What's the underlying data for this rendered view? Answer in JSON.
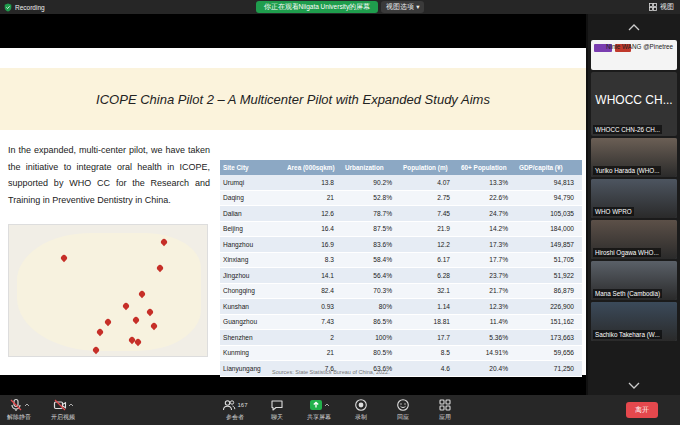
{
  "top_bar": {
    "recording": "Recording",
    "banner": "你正在观看Niigata University的屏幕",
    "view_options": "视图选项",
    "view_options_caret": "▾",
    "view": "视图"
  },
  "slide": {
    "title": "ICOPE China Pilot 2 – A Multicenter Pilot with Expanded Study Aims",
    "paragraph": "In the expanded, multi-center pilot, we have taken the initiative to integrate oral health in ICOPE, supported by WHO CC for the Research and Training in Preventive Dentistry in China.",
    "table": {
      "columns": [
        "Site City",
        "Area (000sqkm)",
        "Urbanization",
        "Population (m)",
        "60+ Population",
        "GDP/capita (¥)"
      ],
      "rows": [
        [
          "Urumqi",
          "13.8",
          "90.2%",
          "4.07",
          "13.3%",
          "94,813"
        ],
        [
          "Daqing",
          "21",
          "52.8%",
          "2.75",
          "22.6%",
          "94,790"
        ],
        [
          "Dalian",
          "12.6",
          "78.7%",
          "7.45",
          "24.7%",
          "105,035"
        ],
        [
          "Beijing",
          "16.4",
          "87.5%",
          "21.9",
          "14.2%",
          "184,000"
        ],
        [
          "Hangzhou",
          "16.9",
          "83.6%",
          "12.2",
          "17.3%",
          "149,857"
        ],
        [
          "Xinxiang",
          "8.3",
          "58.4%",
          "6.17",
          "17.7%",
          "51,705"
        ],
        [
          "Jingzhou",
          "14.1",
          "56.4%",
          "6.28",
          "23.7%",
          "51,922"
        ],
        [
          "Chongqing",
          "82.4",
          "70.3%",
          "32.1",
          "21.7%",
          "86,879"
        ],
        [
          "Kunshan",
          "0.93",
          "80%",
          "1.14",
          "12.3%",
          "226,900"
        ],
        [
          "Guangzhou",
          "7.43",
          "86.5%",
          "18.81",
          "11.4%",
          "151,162"
        ],
        [
          "Shenzhen",
          "2",
          "100%",
          "17.7",
          "5.36%",
          "173,663"
        ],
        [
          "Kunming",
          "21",
          "80.5%",
          "8.5",
          "14.91%",
          "59,656"
        ],
        [
          "Lianyungang",
          "7.6",
          "63.6%",
          "4.6",
          "20.4%",
          "71,250"
        ]
      ]
    },
    "source": "Sources: State Statistics Bureau of China, 2022."
  },
  "participants": [
    {
      "name": "Ninie WANG @Pinetree",
      "kind": "logo"
    },
    {
      "name": "WHOCC CHN-26 CH...",
      "kind": "avatar",
      "avatar_text": "WHOCC CH..."
    },
    {
      "name": "Yuriko Harada (WHO...",
      "kind": "video"
    },
    {
      "name": "WHO WPRO",
      "kind": "video"
    },
    {
      "name": "Hiroshi Ogawa WHO...",
      "kind": "video"
    },
    {
      "name": "Mana Seth (Cambodia)",
      "kind": "video"
    },
    {
      "name": "Sachiko Takehara (W...",
      "kind": "video"
    }
  ],
  "toolbar": {
    "left": [
      {
        "label": "解除静音",
        "kind": "mic-off",
        "has_menu": true,
        "highlighted": false
      },
      {
        "label": "开启视频",
        "kind": "video-off",
        "has_menu": true,
        "highlighted": false
      }
    ],
    "center": [
      {
        "label": "参会者",
        "kind": "participants",
        "count": "167",
        "has_menu": false,
        "highlighted": false
      },
      {
        "label": "聊天",
        "kind": "chat",
        "has_menu": false,
        "highlighted": false
      },
      {
        "label": "共享屏幕",
        "kind": "share",
        "has_menu": true,
        "highlighted": true
      },
      {
        "label": "录制",
        "kind": "record",
        "has_menu": false,
        "highlighted": false
      },
      {
        "label": "回应",
        "kind": "react",
        "has_menu": false,
        "highlighted": false
      },
      {
        "label": "应用",
        "kind": "apps",
        "has_menu": false,
        "highlighted": false
      }
    ],
    "leave": "离开"
  }
}
